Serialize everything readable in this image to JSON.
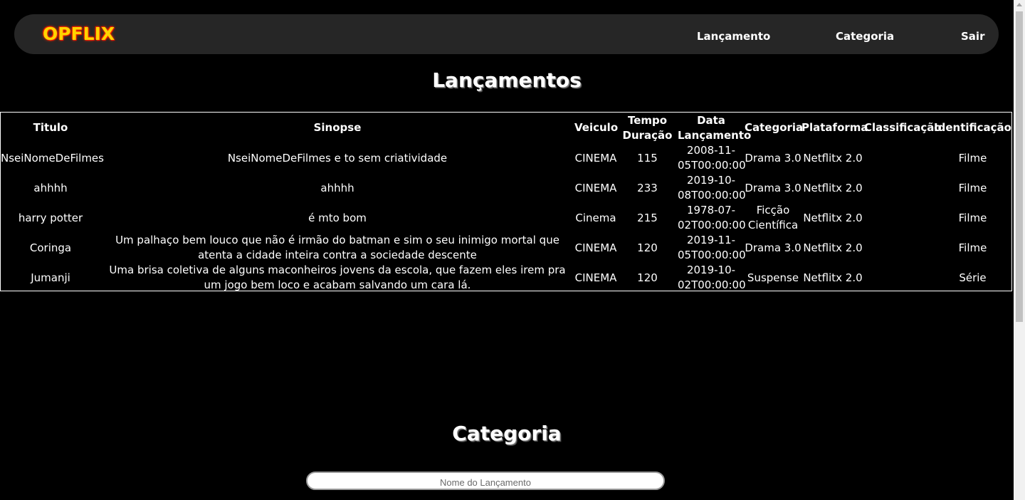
{
  "brand": {
    "logo_text": "OPFLIX"
  },
  "nav": {
    "items": [
      {
        "label": "Lançamento"
      },
      {
        "label": "Categoria"
      },
      {
        "label": "Sair"
      }
    ]
  },
  "sections": {
    "lancamentos_title": "Lançamentos",
    "categoria_title": "Categoria"
  },
  "table": {
    "headers": [
      "Titulo",
      "Sinopse",
      "Veiculo",
      "Tempo Duração",
      "Data Lançamento",
      "Categoria",
      "Plataforma",
      "Classificação",
      "Identificação"
    ],
    "rows": [
      [
        "NseiNomeDeFilmes",
        "NseiNomeDeFilmes e to sem criatividade",
        "CINEMA",
        "115",
        "2008-11-05T00:00:00",
        "Drama 3.0",
        "Netflitx 2.0",
        "",
        "Filme"
      ],
      [
        "ahhhh",
        "ahhhh",
        "CINEMA",
        "233",
        "2019-10-08T00:00:00",
        "Drama 3.0",
        "Netflitx 2.0",
        "",
        "Filme"
      ],
      [
        "harry potter",
        "é mto bom",
        "Cinema",
        "215",
        "1978-07-02T00:00:00",
        "Ficção Científica",
        "Netflitx 2.0",
        "",
        "Filme"
      ],
      [
        "Coringa",
        "Um palhaço bem louco que não é irmão do batman e sim o seu inimigo mortal que atenta a cidade inteira contra a sociedade descente",
        "CINEMA",
        "120",
        "2019-11-05T00:00:00",
        "Drama 3.0",
        "Netflitx 2.0",
        "",
        "Filme"
      ],
      [
        "Jumanji",
        "Uma brisa coletiva de alguns maconheiros jovens da escola, que fazem eles irem pra um jogo bem loco e acabam salvando um cara lá.",
        "CINEMA",
        "120",
        "2019-10-02T00:00:00",
        "Suspense",
        "Netflitx 2.0",
        "",
        "Série"
      ]
    ]
  },
  "search": {
    "placeholder": "Nome do Lançamento",
    "value": ""
  },
  "colors": {
    "background": "#000000",
    "navbar": "#262626",
    "logo": "#ffd400",
    "logo_glow": "#ff2a00"
  }
}
